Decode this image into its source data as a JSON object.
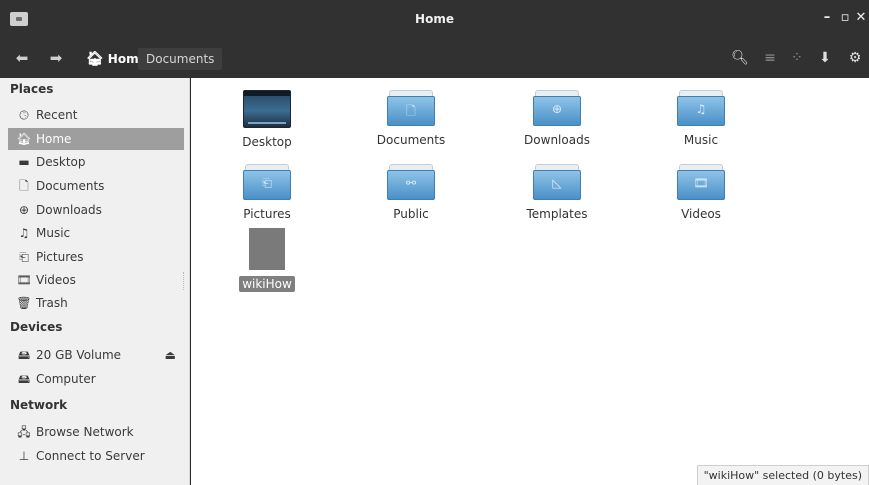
{
  "window": {
    "title": "Home"
  },
  "toolbar": {
    "breadcrumbs": [
      "Home",
      "Documents"
    ]
  },
  "sidebar": {
    "places_title": "Places",
    "places": [
      {
        "label": "Recent",
        "icon": "clock-icon"
      },
      {
        "label": "Home",
        "icon": "home-icon",
        "active": true
      },
      {
        "label": "Desktop",
        "icon": "desktop-icon"
      },
      {
        "label": "Documents",
        "icon": "document-icon"
      },
      {
        "label": "Downloads",
        "icon": "download-icon"
      },
      {
        "label": "Music",
        "icon": "music-icon"
      },
      {
        "label": "Pictures",
        "icon": "pictures-icon"
      },
      {
        "label": "Videos",
        "icon": "video-icon"
      },
      {
        "label": "Trash",
        "icon": "trash-icon"
      }
    ],
    "devices_title": "Devices",
    "devices": [
      {
        "label": "20 GB Volume",
        "icon": "drive-icon"
      },
      {
        "label": "Computer",
        "icon": "drive-icon"
      }
    ],
    "network_title": "Network",
    "network": [
      {
        "label": "Browse Network",
        "icon": "network-icon"
      },
      {
        "label": "Connect to Server",
        "icon": "server-icon"
      }
    ]
  },
  "files": [
    {
      "label": "Desktop",
      "type": "desktop"
    },
    {
      "label": "Documents",
      "type": "folder"
    },
    {
      "label": "Downloads",
      "type": "folder"
    },
    {
      "label": "Music",
      "type": "folder"
    },
    {
      "label": "Pictures",
      "type": "folder"
    },
    {
      "label": "Public",
      "type": "folder"
    },
    {
      "label": "Templates",
      "type": "folder"
    },
    {
      "label": "Videos",
      "type": "folder"
    },
    {
      "label": "wikiHow",
      "type": "file",
      "selected": true
    }
  ],
  "status": {
    "text": "\"wikiHow\" selected  (0 bytes)"
  },
  "colors": {
    "titlebar": "#313131",
    "sidebar_active": "#9e9e9e",
    "folder_blue": "#4a90c7"
  }
}
